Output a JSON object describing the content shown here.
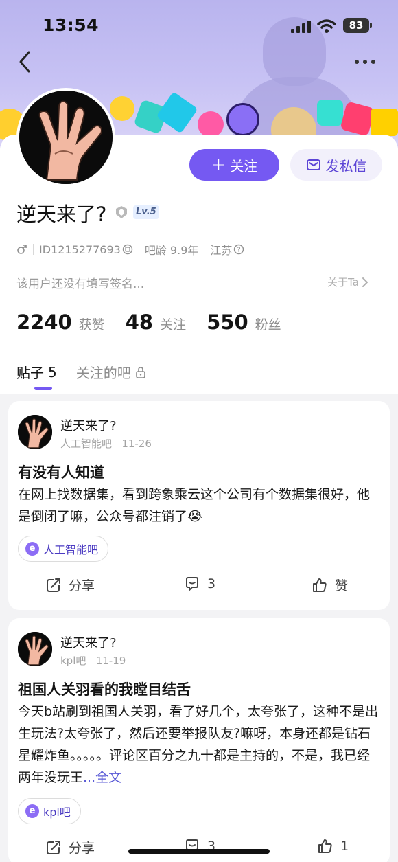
{
  "status_bar": {
    "time": "13:54",
    "battery": "83"
  },
  "profile": {
    "username": "逆天来了?",
    "level": "Lv.5",
    "follow_label": "关注",
    "message_label": "发私信",
    "gender_icon": "male-icon",
    "id_text": "ID1215277693",
    "bar_age": "吧龄 9.9年",
    "location": "江苏",
    "signature": "该用户还没有填写签名...",
    "about_label": "关于Ta"
  },
  "stats": [
    {
      "num": "2240",
      "label": "获赞"
    },
    {
      "num": "48",
      "label": "关注"
    },
    {
      "num": "550",
      "label": "粉丝"
    }
  ],
  "tabs": [
    {
      "label": "贴子",
      "count": "5"
    },
    {
      "label": "关注的吧"
    }
  ],
  "posts": [
    {
      "author": "逆天来了?",
      "forum": "人工智能吧",
      "time": "11-26",
      "title": "有没有人知道",
      "body": "在网上找数据集，看到跨象乘云这个公司有个数据集很好，他是倒闭了嘛，公众号都注销了😭",
      "tag": "人工智能吧",
      "share_label": "分享",
      "comments": "3",
      "like_label": "赞"
    },
    {
      "author": "逆天来了?",
      "forum": "kpl吧",
      "time": "11-19",
      "title": "祖国人关羽看的我瞠目结舌",
      "body": "今天b站刷到祖国人关羽，看了好几个，太夸张了，这种不是出生玩法?太夸张了，然后还要举报队友?嘛呀，本身还都是钻石星耀炸鱼。。。。。评论区百分之九十都是主持的，不是，我已经两年没玩王",
      "more_label": "...全文",
      "tag": "kpl吧",
      "share_label": "分享",
      "comments": "3",
      "likes": "1"
    }
  ],
  "colors": {
    "accent": "#7559f2",
    "banner": "#c7c2f4"
  }
}
